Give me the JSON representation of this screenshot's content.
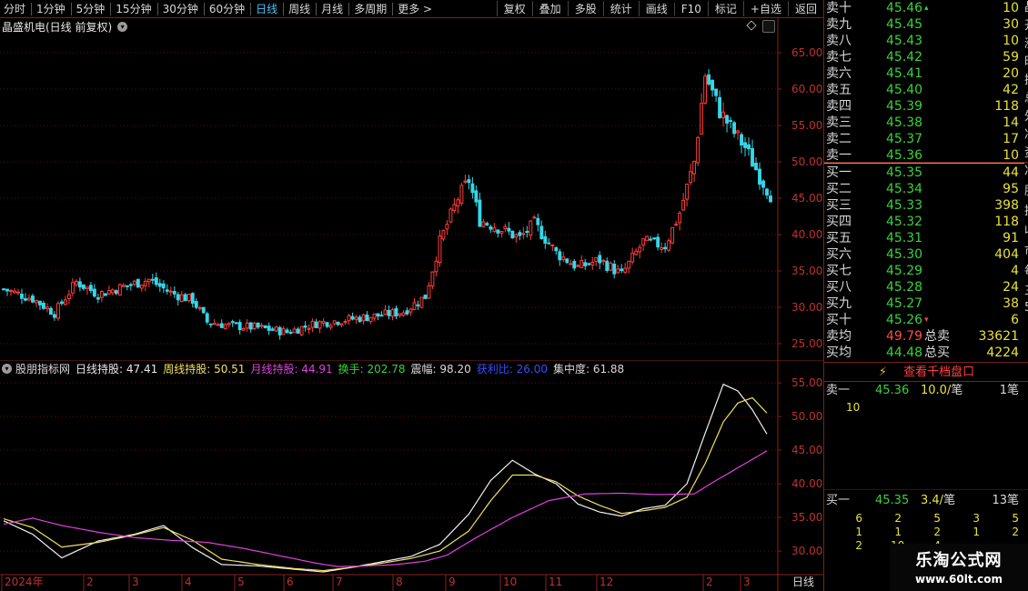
{
  "colors": {
    "up": "#ff3c3c",
    "down": "#35d7e8",
    "grid": "#5a1010",
    "axis": "#8a1f1f",
    "white_line": "#f0f0f0",
    "yellow_line": "#f0e060",
    "magenta_line": "#e040e0",
    "ask_green": "#3bd13b",
    "volume_yellow": "#e8e23a"
  },
  "topbar": {
    "periods": [
      "分时",
      "1分钟",
      "5分钟",
      "15分钟",
      "30分钟",
      "60分钟",
      "日线",
      "周线",
      "月线",
      "多周期",
      "更多 >"
    ],
    "active_period": 6,
    "tools": [
      "复权",
      "叠加",
      "多股",
      "统计",
      "画线",
      "F10",
      "标记",
      "+自选",
      "返回"
    ]
  },
  "title": {
    "stock_name": "晶盛机电(日线 前复权)"
  },
  "indicator": {
    "legend": [
      {
        "text": "股朋指标网",
        "color": "#d8d8d8"
      },
      {
        "text": "日线持股: 47.41",
        "color": "#e8e8e8"
      },
      {
        "text": "周线持股: 50.51",
        "color": "#f0e060"
      },
      {
        "text": "月线持股: 44.91",
        "color": "#e040e0"
      },
      {
        "text": "换手: 202.78",
        "color": "#3bd13b"
      },
      {
        "text": "震幅: 98.20",
        "color": "#d8d8d8"
      },
      {
        "text": "获利比: 26.00",
        "color": "#3a4cff"
      },
      {
        "text": "集中度: 61.88",
        "color": "#d8d8d8"
      }
    ]
  },
  "chart_data": [
    {
      "type": "candlestick",
      "yticks": [
        25.0,
        30.0,
        35.0,
        40.0,
        45.0,
        50.0,
        55.0,
        60.0,
        65.0
      ],
      "ylim": [
        23.0,
        67.5
      ],
      "xticks": [
        "2024年",
        "2",
        "3",
        "4",
        "5",
        "6",
        "7",
        "8",
        "9",
        "10",
        "11",
        "12",
        "2",
        "3"
      ],
      "close_path": [
        [
          0,
          32.5
        ],
        [
          8,
          31.2
        ],
        [
          14,
          29.2
        ],
        [
          20,
          33.5
        ],
        [
          26,
          31.8
        ],
        [
          34,
          33.0
        ],
        [
          40,
          33.8
        ],
        [
          46,
          32.0
        ],
        [
          52,
          31.0
        ],
        [
          56,
          28.0
        ],
        [
          62,
          27.5
        ],
        [
          70,
          27.2
        ],
        [
          78,
          26.6
        ],
        [
          86,
          27.8
        ],
        [
          94,
          28.3
        ],
        [
          102,
          28.8
        ],
        [
          110,
          29.4
        ],
        [
          116,
          31.5
        ],
        [
          120,
          39.0
        ],
        [
          125,
          45.0
        ],
        [
          128,
          47.5
        ],
        [
          131,
          42.0
        ],
        [
          136,
          41.0
        ],
        [
          142,
          39.5
        ],
        [
          146,
          41.5
        ],
        [
          152,
          37.5
        ],
        [
          158,
          35.5
        ],
        [
          164,
          36.5
        ],
        [
          170,
          34.5
        ],
        [
          176,
          39.0
        ],
        [
          182,
          38.5
        ],
        [
          186,
          43.0
        ],
        [
          190,
          50.0
        ],
        [
          193,
          62.0
        ],
        [
          197,
          57.0
        ],
        [
          201,
          54.0
        ],
        [
          204,
          52.0
        ],
        [
          208,
          48.0
        ],
        [
          211,
          45.5
        ]
      ],
      "x_count": 212
    },
    {
      "type": "line",
      "yticks": [
        30.0,
        35.0,
        40.0,
        45.0,
        50.0,
        55.0
      ],
      "ylim": [
        26.5,
        56.5
      ],
      "series": [
        {
          "color": "white",
          "values": [
            [
              0,
              34.5
            ],
            [
              8,
              32.5
            ],
            [
              16,
              29.0
            ],
            [
              26,
              31.5
            ],
            [
              36,
              32.5
            ],
            [
              44,
              33.8
            ],
            [
              52,
              30.5
            ],
            [
              60,
              28.0
            ],
            [
              70,
              27.8
            ],
            [
              80,
              27.3
            ],
            [
              88,
              26.9
            ],
            [
              96,
              27.6
            ],
            [
              104,
              28.4
            ],
            [
              112,
              29.2
            ],
            [
              120,
              31.0
            ],
            [
              128,
              35.5
            ],
            [
              134,
              40.5
            ],
            [
              140,
              43.5
            ],
            [
              146,
              41.5
            ],
            [
              152,
              40.0
            ],
            [
              158,
              37.0
            ],
            [
              164,
              35.8
            ],
            [
              170,
              35.2
            ],
            [
              176,
              36.3
            ],
            [
              182,
              36.8
            ],
            [
              188,
              40.0
            ],
            [
              193,
              47.5
            ],
            [
              198,
              54.8
            ],
            [
              202,
              53.8
            ],
            [
              206,
              51.0
            ],
            [
              210,
              47.4
            ]
          ]
        },
        {
          "color": "yellow",
          "values": [
            [
              0,
              34.8
            ],
            [
              8,
              33.5
            ],
            [
              16,
              30.6
            ],
            [
              26,
              31.3
            ],
            [
              36,
              32.4
            ],
            [
              44,
              33.5
            ],
            [
              52,
              31.6
            ],
            [
              60,
              28.8
            ],
            [
              70,
              28.0
            ],
            [
              80,
              27.4
            ],
            [
              88,
              27.1
            ],
            [
              96,
              27.6
            ],
            [
              104,
              28.2
            ],
            [
              112,
              28.9
            ],
            [
              120,
              30.0
            ],
            [
              128,
              33.0
            ],
            [
              134,
              37.5
            ],
            [
              140,
              41.3
            ],
            [
              146,
              41.3
            ],
            [
              152,
              40.3
            ],
            [
              158,
              38.2
            ],
            [
              164,
              36.8
            ],
            [
              170,
              35.6
            ],
            [
              176,
              36.0
            ],
            [
              182,
              36.5
            ],
            [
              188,
              38.0
            ],
            [
              193,
              43.0
            ],
            [
              198,
              49.2
            ],
            [
              202,
              52.0
            ],
            [
              206,
              52.8
            ],
            [
              210,
              50.5
            ]
          ]
        },
        {
          "color": "magenta",
          "values": [
            [
              0,
              34.0
            ],
            [
              8,
              34.9
            ],
            [
              16,
              33.8
            ],
            [
              26,
              32.8
            ],
            [
              36,
              32.0
            ],
            [
              46,
              31.6
            ],
            [
              56,
              31.3
            ],
            [
              66,
              30.4
            ],
            [
              76,
              29.3
            ],
            [
              86,
              28.2
            ],
            [
              92,
              27.7
            ],
            [
              100,
              27.8
            ],
            [
              108,
              28.0
            ],
            [
              116,
              28.5
            ],
            [
              122,
              29.4
            ],
            [
              130,
              32.0
            ],
            [
              140,
              35.0
            ],
            [
              150,
              37.5
            ],
            [
              160,
              38.5
            ],
            [
              170,
              38.6
            ],
            [
              180,
              38.4
            ],
            [
              190,
              38.5
            ],
            [
              196,
              40.5
            ],
            [
              204,
              43.0
            ],
            [
              210,
              44.9
            ]
          ]
        }
      ]
    }
  ],
  "orderbook": {
    "asks": [
      {
        "label": "卖十",
        "price": "45.46",
        "volume": "10",
        "mark": "up"
      },
      {
        "label": "卖九",
        "price": "45.45",
        "volume": "30"
      },
      {
        "label": "卖八",
        "price": "45.43",
        "volume": "10"
      },
      {
        "label": "卖七",
        "price": "45.42",
        "volume": "59"
      },
      {
        "label": "卖六",
        "price": "45.41",
        "volume": "20"
      },
      {
        "label": "卖五",
        "price": "45.40",
        "volume": "42"
      },
      {
        "label": "卖四",
        "price": "45.39",
        "volume": "118"
      },
      {
        "label": "卖三",
        "price": "45.38",
        "volume": "14"
      },
      {
        "label": "卖二",
        "price": "45.37",
        "volume": "17"
      },
      {
        "label": "卖一",
        "price": "45.36",
        "volume": "10"
      }
    ],
    "bids": [
      {
        "label": "买一",
        "price": "45.35",
        "volume": "44"
      },
      {
        "label": "买二",
        "price": "45.34",
        "volume": "95"
      },
      {
        "label": "买三",
        "price": "45.33",
        "volume": "398"
      },
      {
        "label": "买四",
        "price": "45.32",
        "volume": "118"
      },
      {
        "label": "买五",
        "price": "45.31",
        "volume": "91"
      },
      {
        "label": "买六",
        "price": "45.30",
        "volume": "404"
      },
      {
        "label": "买七",
        "price": "45.29",
        "volume": "4"
      },
      {
        "label": "买八",
        "price": "45.28",
        "volume": "24"
      },
      {
        "label": "买九",
        "price": "45.27",
        "volume": "38"
      },
      {
        "label": "买十",
        "price": "45.26",
        "volume": "6",
        "mark": "down"
      }
    ],
    "summary": [
      {
        "label": "卖均",
        "value": "49.79",
        "value_color": "#ff4a4a",
        "label2": "总卖",
        "value2": "33621"
      },
      {
        "label": "买均",
        "value": "44.48",
        "value_color": "#3bd13b",
        "label2": "总买",
        "value2": "4224"
      }
    ],
    "right_edge_chars": [
      "晶",
      "开",
      "涨",
      "昨",
      "换",
      "总",
      "外",
      "净",
      "资",
      "净",
      "股",
      "换",
      "收",
      "市",
      "每",
      "三",
      "5"
    ]
  },
  "queue": {
    "button_label": "查看千档盘口",
    "sell": {
      "label": "卖一",
      "price": "45.36",
      "amount": "10.0/",
      "unit": "笔",
      "count": "1",
      "count_unit": "笔",
      "orders": [
        "10"
      ]
    },
    "buy": {
      "label": "买一",
      "price": "45.35",
      "amount": "3.4/",
      "unit": "笔",
      "count": "13",
      "count_unit": "笔",
      "orders": [
        [
          "6",
          "2",
          "5",
          "3",
          "5"
        ],
        [
          "1",
          "1",
          "2",
          "1",
          "2"
        ],
        [
          "2",
          "10",
          "4"
        ]
      ]
    }
  },
  "bottom_tab": "日线",
  "watermark": {
    "line1": "乐淘公式网",
    "line2": "www.60lt.com"
  }
}
